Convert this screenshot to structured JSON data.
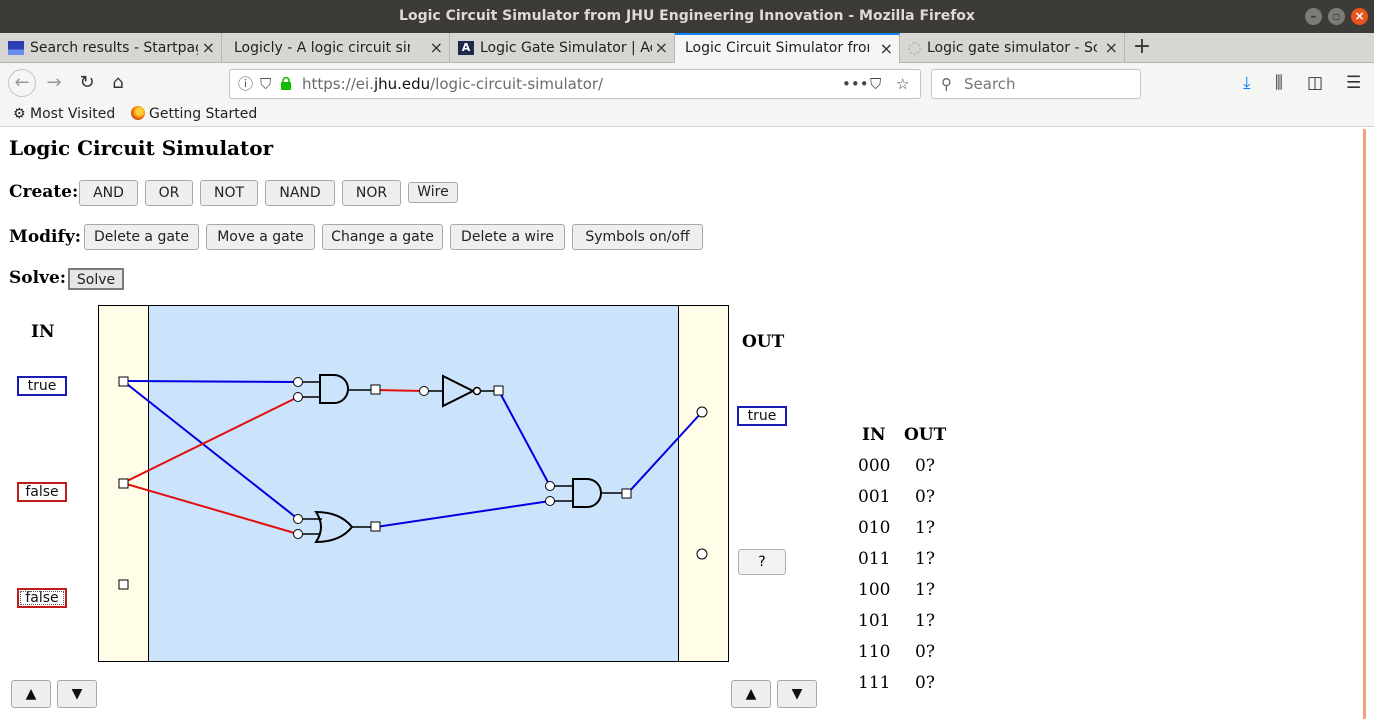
{
  "window": {
    "title": "Logic Circuit Simulator from JHU Engineering Innovation - Mozilla Firefox"
  },
  "tabs": [
    {
      "label": "Search results - Startpage",
      "icon": "startpage-icon"
    },
    {
      "label": "Logicly - A logic circuit simul",
      "icon": "none"
    },
    {
      "label": "Logic Gate Simulator | Ac",
      "icon": "academo-icon"
    },
    {
      "label": "Logic Circuit Simulator from",
      "icon": "none",
      "active": true
    },
    {
      "label": "Logic gate simulator - Sc",
      "icon": "spinner-icon"
    }
  ],
  "navbar": {
    "url_prefix": "https://ei.",
    "url_domain": "jhu.edu",
    "url_path": "/logic-circuit-simulator/",
    "search_placeholder": "Search"
  },
  "bookmarks": [
    {
      "label": "Most Visited",
      "icon": "gear-icon"
    },
    {
      "label": "Getting Started",
      "icon": "firefox-icon"
    }
  ],
  "page": {
    "title": "Logic Circuit Simulator",
    "create": {
      "label": "Create:",
      "buttons": [
        "AND",
        "OR",
        "NOT",
        "NAND",
        "NOR",
        "Wire"
      ]
    },
    "modify": {
      "label": "Modify:",
      "buttons": [
        "Delete a gate",
        "Move a gate",
        "Change a gate",
        "Delete a wire",
        "Symbols on/off"
      ]
    },
    "solve": {
      "label": "Solve:",
      "button": "Solve"
    },
    "in_header": "IN",
    "out_header": "OUT",
    "inputs": [
      "true",
      "false",
      "false"
    ],
    "outputs": [
      "true",
      "?"
    ],
    "arrow_up": "▲",
    "arrow_down": "▼"
  },
  "truth_table": {
    "headers": [
      "IN",
      "OUT"
    ],
    "rows": [
      [
        "000",
        "0?"
      ],
      [
        "001",
        "0?"
      ],
      [
        "010",
        "1?"
      ],
      [
        "011",
        "1?"
      ],
      [
        "100",
        "1?"
      ],
      [
        "101",
        "1?"
      ],
      [
        "110",
        "0?"
      ],
      [
        "111",
        "0?"
      ]
    ]
  },
  "colors": {
    "true_wire": "#0000e0",
    "false_wire": "#e01010",
    "canvas_bg": "#cce4fb",
    "side_bg": "#fffde7",
    "accent": "#0a84ff"
  }
}
